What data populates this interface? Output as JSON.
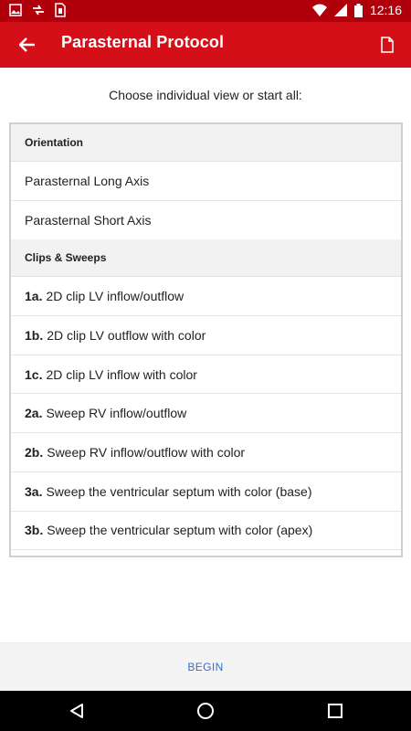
{
  "status_bar": {
    "time": "12:16",
    "left_icons": [
      "image-icon",
      "sync-icon",
      "sim-icon"
    ],
    "right_icons": [
      "wifi-icon",
      "signal-icon",
      "battery-icon"
    ]
  },
  "app_bar": {
    "title": "Parasternal Protocol",
    "back_icon": "arrow-back-icon",
    "action_icon": "document-icon",
    "color": "#d50f17",
    "status_color": "#b0000b"
  },
  "instruction": "Choose individual view or start all:",
  "sections": [
    {
      "header": "Orientation",
      "items": [
        {
          "num": "",
          "label": "Parasternal Long Axis"
        },
        {
          "num": "",
          "label": "Parasternal Short Axis"
        }
      ]
    },
    {
      "header": "Clips & Sweeps",
      "items": [
        {
          "num": "1a.",
          "label": "2D clip LV inflow/outflow"
        },
        {
          "num": "1b.",
          "label": "2D clip LV outflow with color"
        },
        {
          "num": "1c.",
          "label": "2D clip LV inflow with color"
        },
        {
          "num": "2a.",
          "label": "Sweep RV inflow/outflow"
        },
        {
          "num": "2b.",
          "label": "Sweep RV inflow/outflow with color"
        },
        {
          "num": "3a.",
          "label": "Sweep the ventricular septum with color (base)"
        },
        {
          "num": "3b.",
          "label": "Sweep the ventricular septum with color (apex)"
        }
      ]
    }
  ],
  "footer": {
    "begin_label": "BEGIN",
    "accent": "#2a6fdb"
  },
  "nav_bar": {
    "icons": [
      "back-triangle-icon",
      "home-circle-icon",
      "recents-square-icon"
    ]
  }
}
